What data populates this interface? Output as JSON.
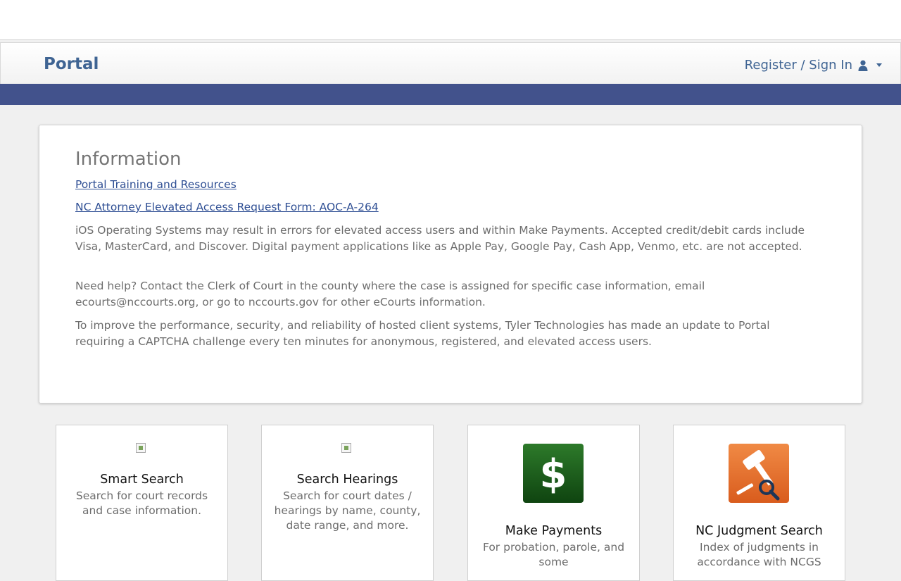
{
  "header": {
    "brand": "Portal",
    "signin_label": "Register / Sign In"
  },
  "icons": {
    "user": "user-icon",
    "caret": "caret-down-icon",
    "dollar": "dollar-icon",
    "gavel": "gavel-search-icon"
  },
  "colors": {
    "brand": "#3f6493",
    "band": "#42528c",
    "link": "#2f4f94",
    "payments_icon": "#185c18",
    "judgment_icon": "#e06f2d"
  },
  "info": {
    "title": "Information",
    "links": [
      "Portal Training and Resources",
      "NC Attorney Elevated Access Request Form: AOC-A-264"
    ],
    "paragraphs": [
      "iOS Operating Systems may result in errors for elevated access users and within Make Payments. Accepted credit/debit cards include Visa, MasterCard, and Discover. Digital payment applications like as Apple Pay, Google Pay, Cash App, Venmo, etc. are not accepted.",
      "Need help? Contact the Clerk of Court in the county where the case is assigned for specific case information, email ecourts@nccourts.org, or go to nccourts.gov for other eCourts information.",
      "To improve the performance, security, and reliability of hosted client systems, Tyler Technologies has made an update to Portal requiring a CAPTCHA challenge every ten minutes for anonymous, registered, and elevated access users."
    ]
  },
  "tiles": [
    {
      "title": "Smart Search",
      "desc": "Search for court records and case information."
    },
    {
      "title": "Search Hearings",
      "desc": "Search for court dates / hearings by name, county, date range, and more."
    },
    {
      "title": "Make Payments",
      "desc": "For probation, parole, and some"
    },
    {
      "title": "NC Judgment Search",
      "desc": "Index of judgments in accordance with NCGS"
    }
  ]
}
